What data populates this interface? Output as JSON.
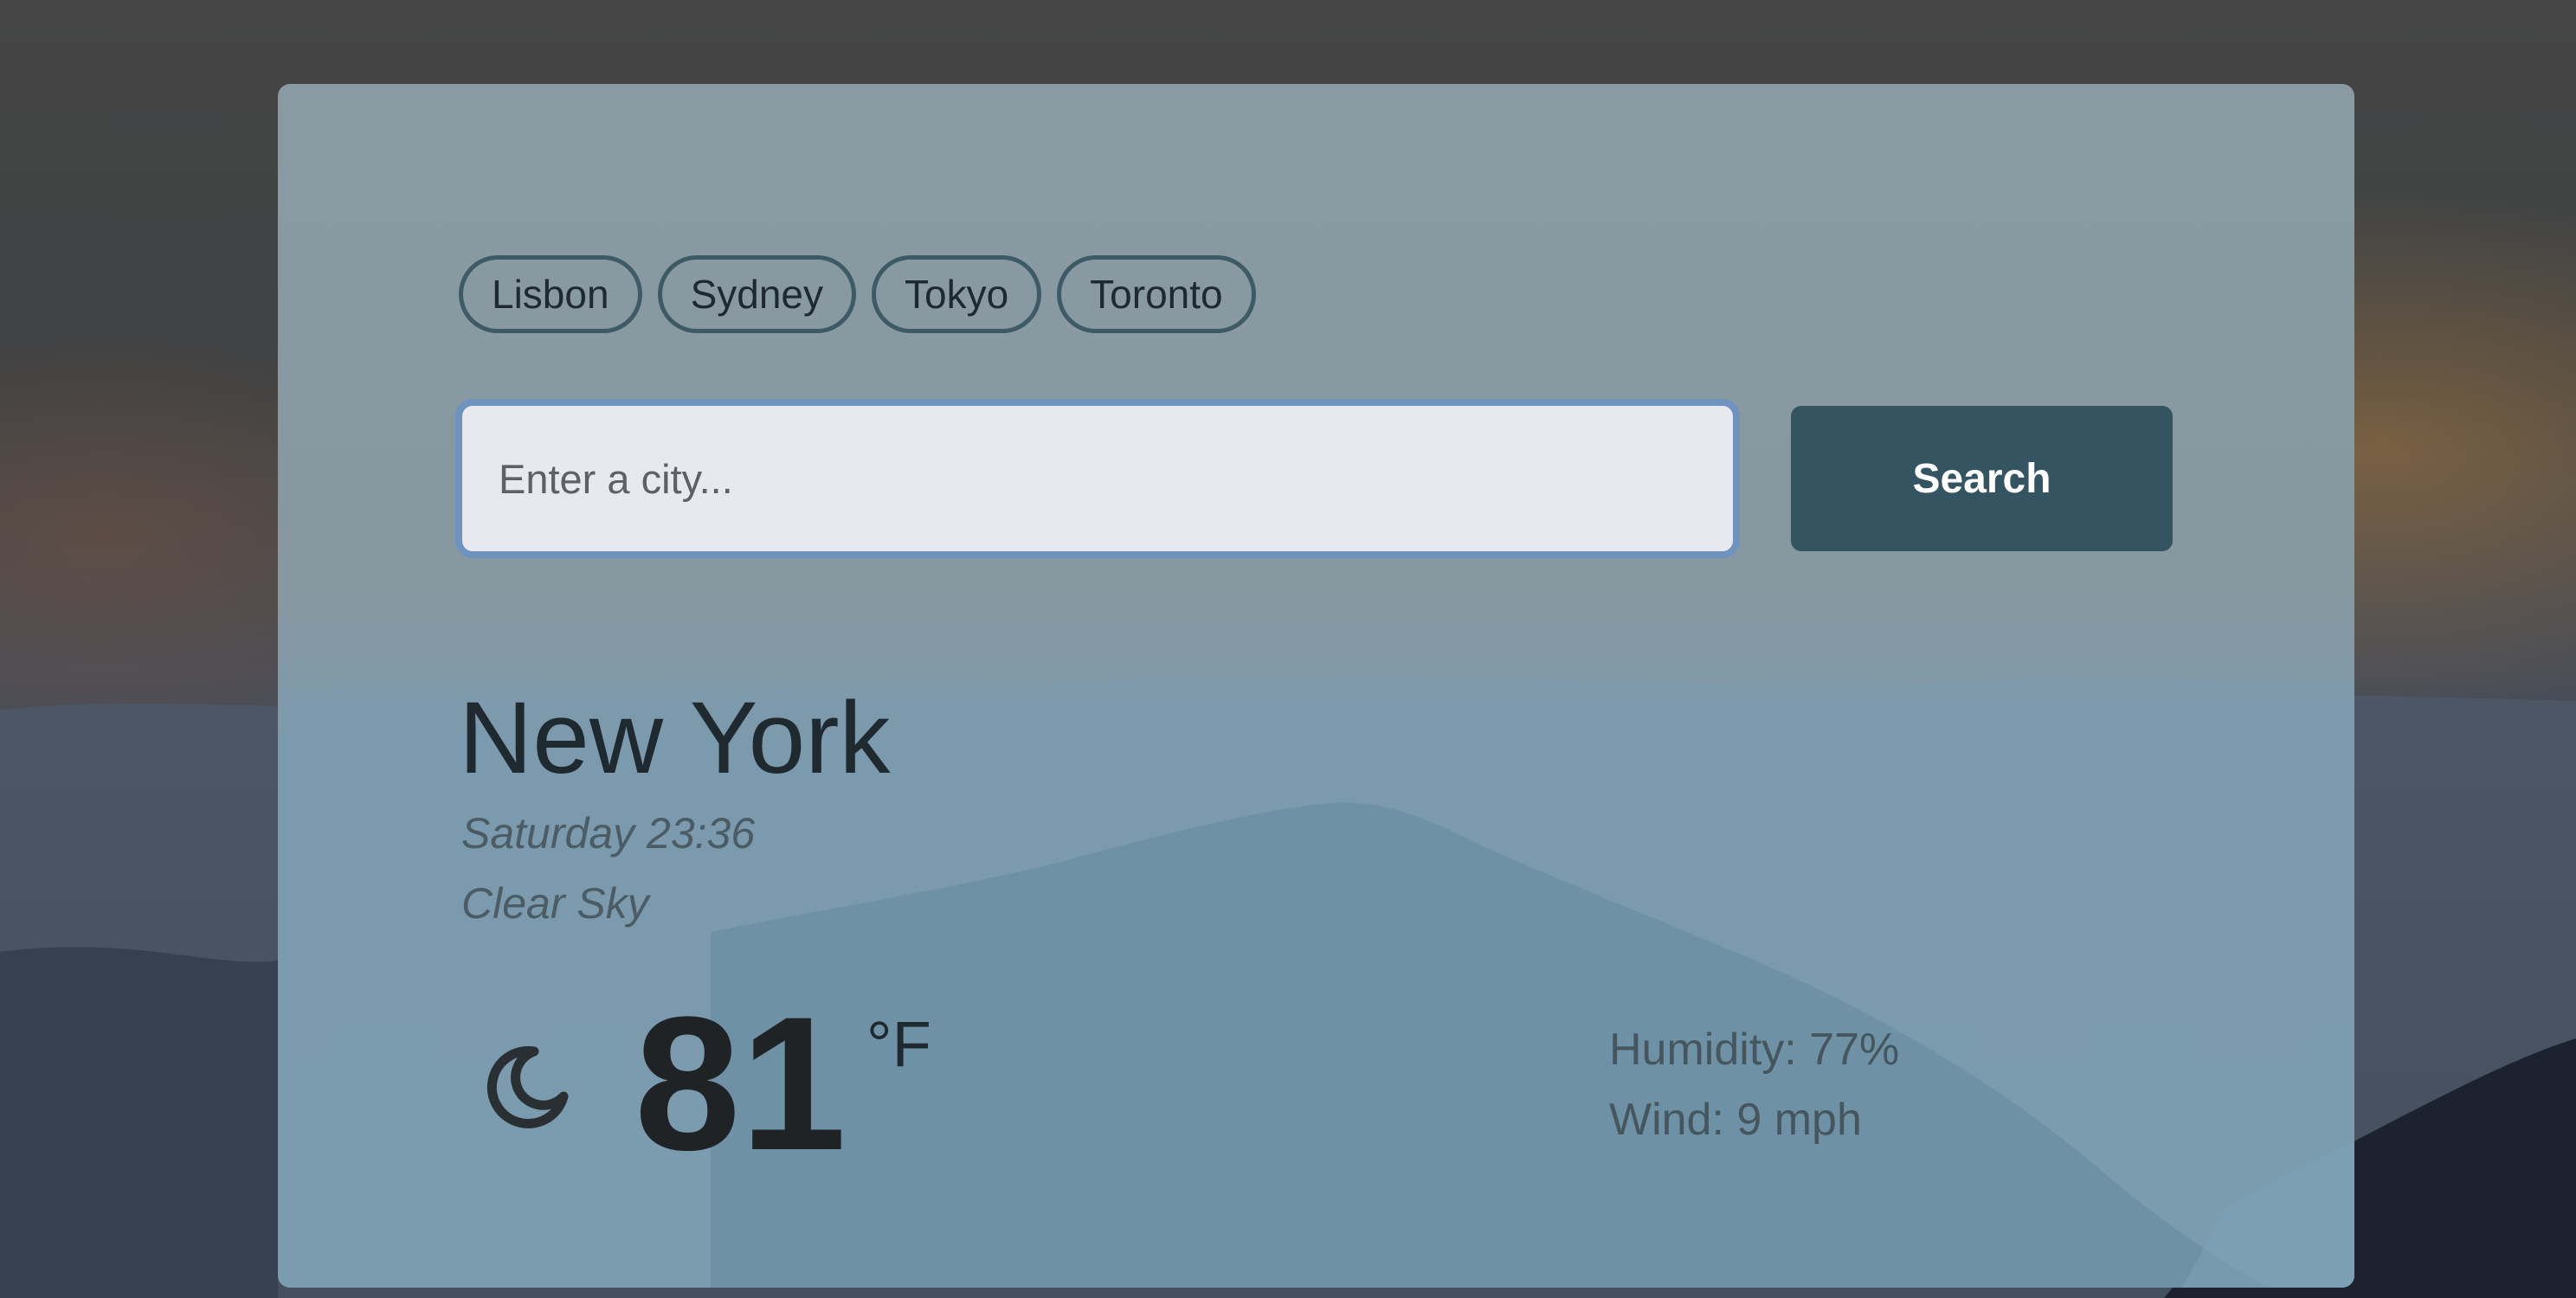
{
  "quick_cities": [
    "Lisbon",
    "Sydney",
    "Tokyo",
    "Toronto"
  ],
  "search": {
    "placeholder": "Enter a city...",
    "value": "",
    "button_label": "Search"
  },
  "weather": {
    "city": "New York",
    "datetime": "Saturday 23:36",
    "description": "Clear Sky",
    "icon": "moon-icon",
    "temperature": "81",
    "unit": "°F",
    "humidity": "Humidity: 77%",
    "wind": "Wind: 9 mph"
  },
  "colors": {
    "accent": "#345461",
    "input_focus": "#6e93be",
    "chip_border": "#3e5a66"
  }
}
